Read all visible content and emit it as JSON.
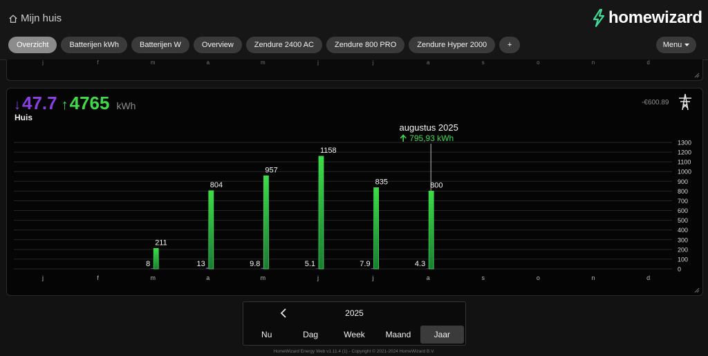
{
  "header": {
    "home_label": "Mijn huis",
    "brand": "homewizard"
  },
  "tabs": [
    {
      "label": "Overzicht",
      "active": true
    },
    {
      "label": "Batterijen kWh",
      "active": false
    },
    {
      "label": "Batterijen W",
      "active": false
    },
    {
      "label": "Overview",
      "active": false
    },
    {
      "label": "Zendure 2400 AC",
      "active": false
    },
    {
      "label": "Zendure 800 PRO",
      "active": false
    },
    {
      "label": "Zendure Hyper 2000",
      "active": false
    },
    {
      "label": "+",
      "active": false
    }
  ],
  "menu_label": "Menu",
  "prev_card_ticks": [
    "j",
    "f",
    "m",
    "a",
    "m",
    "j",
    "j",
    "a",
    "s",
    "o",
    "n",
    "d"
  ],
  "card": {
    "import_value": "47.7",
    "export_value": "4765",
    "unit": "kWh",
    "name": "Huis",
    "cost": "-€600.89"
  },
  "tooltip": {
    "title": "augustus 2025",
    "value": "795,93 kWh"
  },
  "chart_data": {
    "type": "bar",
    "categories": [
      "j",
      "f",
      "m",
      "a",
      "m",
      "j",
      "j",
      "a",
      "s",
      "o",
      "n",
      "d"
    ],
    "series": [
      {
        "values": [
          null,
          null,
          8,
          13,
          9.8,
          5.1,
          7.9,
          4.3,
          null,
          null,
          null,
          null
        ],
        "labels": [
          "",
          "",
          "8",
          "13",
          "9.8",
          "5.1",
          "7.9",
          "4.3",
          "",
          "",
          "",
          ""
        ]
      },
      {
        "values": [
          null,
          null,
          211,
          804,
          957,
          1158,
          835,
          800,
          null,
          null,
          null,
          null
        ],
        "labels": [
          "",
          "",
          "211",
          "804",
          "957",
          "1158",
          "835",
          "800",
          "",
          "",
          "",
          ""
        ]
      }
    ],
    "ylim": [
      0,
      1300
    ],
    "yticks": [
      0,
      100,
      200,
      300,
      400,
      500,
      600,
      700,
      800,
      900,
      1000,
      1100,
      1200,
      1300
    ],
    "grid": true,
    "highlight_category": "a",
    "colors": {
      "import": "#8a3fe0",
      "export": "#3ddc47"
    }
  },
  "period_selector": {
    "year": "2025",
    "options": [
      {
        "label": "Nu",
        "active": false
      },
      {
        "label": "Dag",
        "active": false
      },
      {
        "label": "Week",
        "active": false
      },
      {
        "label": "Maand",
        "active": false
      },
      {
        "label": "Jaar",
        "active": true
      }
    ]
  },
  "footer": "HomeWizard Energy Web v1.11.4 (1) - Copyright © 2021-2024 HomeWizard B.V.",
  "icons": [
    "home-icon",
    "homewizard-bolt-icon",
    "caret-down-icon",
    "power-pylon-icon",
    "chevron-left-icon",
    "resize-icon"
  ]
}
